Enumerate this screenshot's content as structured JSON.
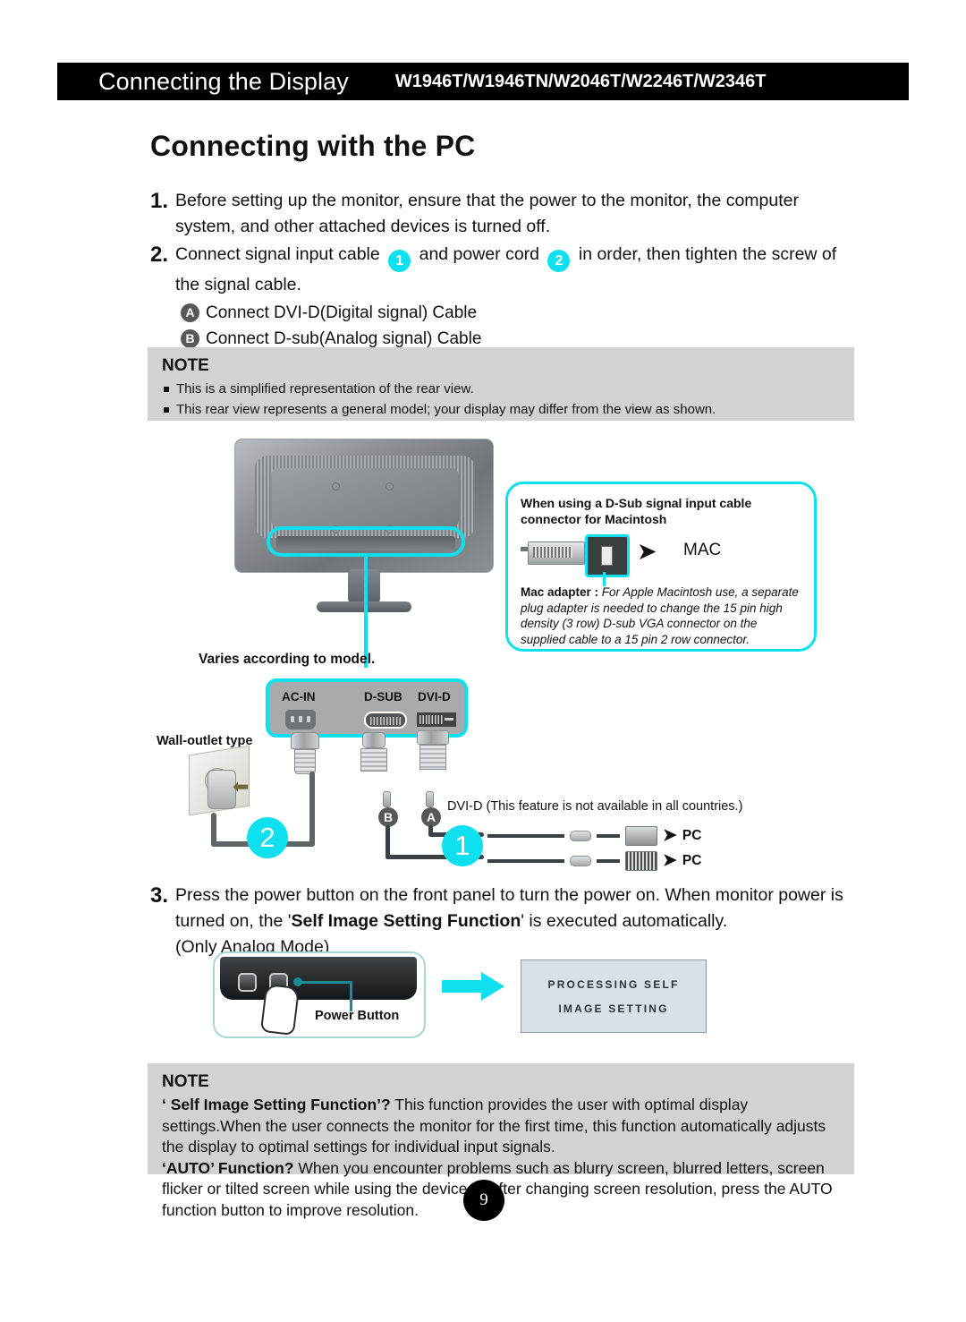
{
  "header": {
    "chapter_title": "Connecting the Display",
    "models": "W1946T/W1946TN/W2046T/W2246T/W2346T"
  },
  "section_title": "Connecting with the PC",
  "steps": [
    {
      "number": "1.",
      "text": "Before setting up the monitor, ensure that the power to the monitor, the computer system, and other attached devices is turned off."
    },
    {
      "number": "2.",
      "text_part1": "Connect signal input cable",
      "badge1": "1",
      "text_part2": "and power cord",
      "badge2": "2",
      "text_part3": "in order, then tighten the screw of the signal cable.",
      "substeps": [
        {
          "badge": "A",
          "text": "Connect DVI-D(Digital signal) Cable"
        },
        {
          "badge": "B",
          "text": "Connect D-sub(Analog signal) Cable"
        }
      ]
    },
    {
      "number": "3.",
      "text_part1": "Press the power button on the front panel to turn the power on. When monitor power is turned on, the '",
      "bold": "Self Image Setting Function",
      "text_part2": "' is executed automatically.",
      "text_part3": "(Only Analog Mode)"
    }
  ],
  "note_top": {
    "title": "NOTE",
    "bullets": [
      "This is a simplified representation of the rear view.",
      "This rear view represents a general model; your display may differ from the view as shown."
    ]
  },
  "note_bottom": {
    "title": "NOTE",
    "para1_bold": "‘ Self Image Setting Function’?",
    "para1": " This function provides the user with optimal display settings.When the user connects the monitor for the first time, this function automatically adjusts the display to optimal settings for individual input signals.",
    "para2_bold": "‘AUTO’ Function?",
    "para2": " When you encounter problems such as blurry screen, blurred letters, screen flicker or tilted screen while using the device or after changing screen resolution, press the AUTO function button to improve resolution."
  },
  "diagram": {
    "varies_label": "Varies according to model.",
    "wall_outlet_label": "Wall-outlet type",
    "ports": [
      {
        "label": "AC-IN"
      },
      {
        "label": "D-SUB"
      },
      {
        "label": "DVI-D"
      }
    ],
    "power_badge": "2",
    "signal_badge": "1",
    "cable_badges": [
      "B",
      "A"
    ],
    "dvid_note": "DVI-D (This feature is not available in all countries.)",
    "pc_rows": [
      "PC",
      "PC"
    ]
  },
  "mac_callout": {
    "heading": "When using a D-Sub signal input cable connector for Macintosh",
    "mac_word": "MAC",
    "body_bold": "Mac adapter :",
    "body": " For Apple Macintosh use, a separate plug adapter is needed to change the 15 pin high density (3 row) D-sub VGA connector on the supplied cable to a 15 pin  2 row connector."
  },
  "power_button_panel": {
    "label": "Power Button"
  },
  "osd": {
    "line1": "PROCESSING SELF",
    "line2": "IMAGE SETTING"
  },
  "page_number": "9",
  "colors": {
    "accent_cyan": "#0FE0EF",
    "note_gray": "#D2D2D2",
    "badge_gray": "#58585A",
    "header_black": "#000000",
    "osd_bg": "#D9E1E8"
  }
}
